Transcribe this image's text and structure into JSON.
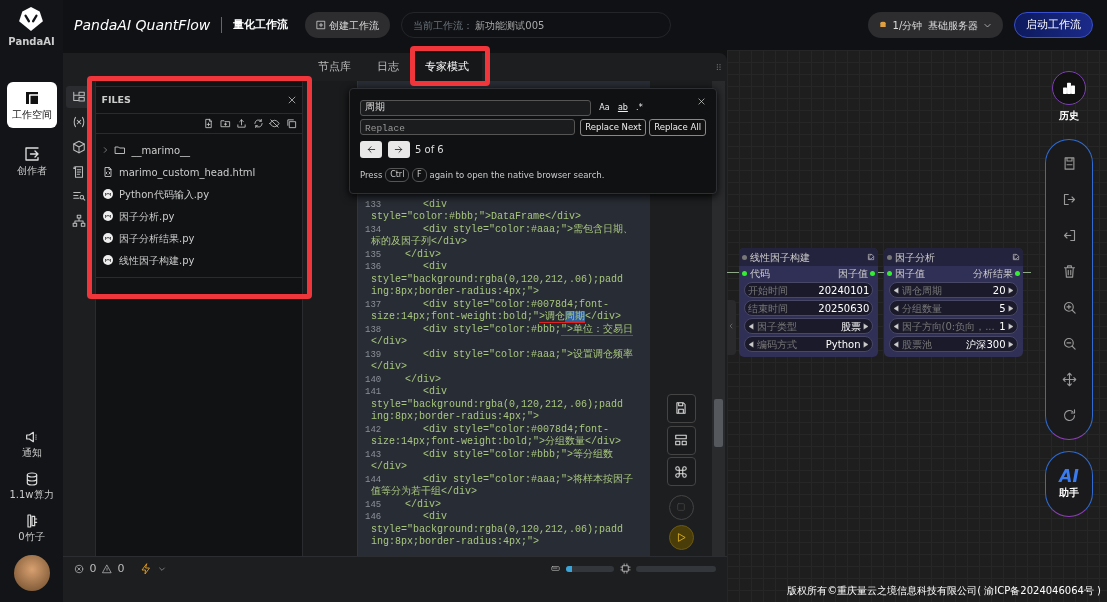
{
  "app": {
    "logo": "PandaAI",
    "title": "PandaAI QuantFlow",
    "subtitle": "量化工作流"
  },
  "rail": {
    "items": [
      {
        "label": "工作空间",
        "selected": true
      },
      {
        "label": "创作者",
        "selected": false
      }
    ],
    "bottom_items": [
      "通知",
      "1.1w算力",
      "0竹子"
    ]
  },
  "header": {
    "create_button": "创建工作流",
    "workflow_label": "当前工作流：",
    "workflow_name": "新功能测试005",
    "server_rate": "1/分钟",
    "server_name": "基础服务器",
    "start_button": "启动工作流"
  },
  "editor": {
    "tabs": [
      {
        "label": "节点库",
        "selected": false
      },
      {
        "label": "日志",
        "selected": false
      },
      {
        "label": "专家模式",
        "selected": true
      }
    ],
    "activity_bar": [
      {
        "selected": true
      },
      {
        "selected": false
      },
      {
        "selected": false
      },
      {
        "selected": false
      },
      {
        "selected": false
      },
      {
        "selected": false
      }
    ],
    "files": {
      "title": "FILES",
      "items": [
        {
          "kind": "folder",
          "name": "__marimo__"
        },
        {
          "kind": "html",
          "name": "marimo_custom_head.html"
        },
        {
          "kind": "notebook",
          "name": "Python代码输入.py"
        },
        {
          "kind": "notebook",
          "name": "因子分析.py"
        },
        {
          "kind": "notebook",
          "name": "因子分析结果.py"
        },
        {
          "kind": "notebook",
          "name": "线性因子构建.py"
        }
      ]
    },
    "find": {
      "query": "周期",
      "replace_placeholder": "Replace",
      "toggles": [
        "Aa",
        "ab",
        ".*"
      ],
      "replace_next": "Replace Next",
      "replace_all": "Replace All",
      "count": "5 of 6",
      "hint": [
        {
          "kind": "text",
          "text": "Press"
        },
        {
          "kind": "key",
          "text": "Ctrl"
        },
        {
          "kind": "key",
          "text": "F"
        },
        {
          "kind": "text",
          "text": "again to open the native browser search."
        }
      ]
    },
    "code_lines": [
      {
        "number": "133",
        "rows": [
          [
            {
              "kind": "plain",
              "text": "    <div"
            }
          ],
          [
            {
              "kind": "plain",
              "text": "style=\"color:#bbb;\">DataFrame</div>"
            }
          ]
        ]
      },
      {
        "number": "134",
        "rows": [
          [
            {
              "kind": "plain",
              "text": "    <div style=\"color:#aaa;\">需包含日期、"
            }
          ],
          [
            {
              "kind": "plain",
              "text": "标的及因子列</div>"
            }
          ]
        ]
      },
      {
        "number": "135",
        "rows": [
          [
            {
              "kind": "plain",
              "text": " </div>"
            }
          ]
        ]
      },
      {
        "number": "136",
        "rows": [
          [
            {
              "kind": "plain",
              "text": "    <div"
            }
          ],
          [
            {
              "kind": "plain",
              "text": "style=\"background:rgba(0,120,212,.06);padd"
            }
          ],
          [
            {
              "kind": "plain",
              "text": "ing:8px;border-radius:4px;\">"
            }
          ]
        ]
      },
      {
        "number": "137",
        "rows": [
          [
            {
              "kind": "plain",
              "text": "    <div style=\"color:#0078d4;font-"
            }
          ],
          [
            {
              "kind": "plain",
              "text": "size:14px;font-weight:bold;\""
            },
            {
              "kind": "flagged",
              "text": ">调仓"
            },
            {
              "kind": "match",
              "text": "周期"
            },
            {
              "kind": "plain",
              "text": "</div>"
            }
          ]
        ]
      },
      {
        "number": "138",
        "rows": [
          [
            {
              "kind": "plain",
              "text": "    <div style=\"color:#bbb;"
            },
            {
              "kind": "flagged",
              "text": "\">单位：交易日"
            }
          ],
          [
            {
              "kind": "plain",
              "text": "</div>"
            }
          ]
        ]
      },
      {
        "number": "139",
        "rows": [
          [
            {
              "kind": "plain",
              "text": "    <div style=\"color:#aaa;\">设置调仓频率"
            }
          ],
          [
            {
              "kind": "plain",
              "text": "</div>"
            }
          ]
        ]
      },
      {
        "number": "140",
        "rows": [
          [
            {
              "kind": "plain",
              "text": " </div>"
            }
          ]
        ]
      },
      {
        "number": "141",
        "rows": [
          [
            {
              "kind": "plain",
              "text": "    <div"
            }
          ],
          [
            {
              "kind": "plain",
              "text": "style=\"background:rgba(0,120,212,.06);padd"
            }
          ],
          [
            {
              "kind": "plain",
              "text": "ing:8px;border-radius:4px;\">"
            }
          ]
        ]
      },
      {
        "number": "142",
        "rows": [
          [
            {
              "kind": "plain",
              "text": "    <div style=\"color:#0078d4;font-"
            }
          ],
          [
            {
              "kind": "plain",
              "text": "size:14px;font-weight:bold;\">分组数量</div>"
            }
          ]
        ]
      },
      {
        "number": "143",
        "rows": [
          [
            {
              "kind": "plain",
              "text": "    <div style=\"color:#bbb;\">等分组数"
            }
          ],
          [
            {
              "kind": "plain",
              "text": "</div>"
            }
          ]
        ]
      },
      {
        "number": "144",
        "rows": [
          [
            {
              "kind": "plain",
              "text": "    <div style=\"color:#aaa;\">将样本按因子"
            }
          ],
          [
            {
              "kind": "plain",
              "text": "值等分为若干组</div>"
            }
          ]
        ]
      },
      {
        "number": "145",
        "rows": [
          [
            {
              "kind": "plain",
              "text": " </div>"
            }
          ]
        ]
      },
      {
        "number": "146",
        "rows": [
          [
            {
              "kind": "plain",
              "text": "    <div"
            }
          ],
          [
            {
              "kind": "plain",
              "text": "style=\"background:rgba(0,120,212,.06);padd"
            }
          ],
          [
            {
              "kind": "plain",
              "text": "ing:8px;border-radius:4px;\">"
            }
          ]
        ]
      }
    ],
    "status": {
      "errors": "0",
      "warnings": "0",
      "memory": {
        "level": 0.12
      },
      "cpu": {
        "level": 0
      }
    }
  },
  "canvas": {
    "nodes": [
      {
        "title": "线性因子构建",
        "input": "代码",
        "output": "因子值",
        "fields": [
          {
            "kind": "text",
            "label": "开始时间",
            "value": "20240101"
          },
          {
            "kind": "text",
            "label": "结束时间",
            "value": "20250630"
          },
          {
            "kind": "stepper",
            "label": "因子类型",
            "value": "股票"
          },
          {
            "kind": "stepper",
            "label": "编码方式",
            "value": "Python"
          }
        ]
      },
      {
        "title": "因子分析",
        "input": "因子值",
        "output": "分析结果",
        "fields": [
          {
            "kind": "stepper",
            "label": "调仓周期",
            "value": "20"
          },
          {
            "kind": "stepper",
            "label": "分组数量",
            "value": "5"
          },
          {
            "kind": "stepper",
            "label": "因子方向(0:负向，...",
            "value": "1"
          },
          {
            "kind": "stepper",
            "label": "股票池",
            "value": "沪深300"
          }
        ]
      }
    ],
    "history": "历史",
    "assistant": {
      "logo": "AI",
      "label": "助手"
    },
    "copyright": "版权所有©重庆量云之境信息科技有限公司( 渝ICP备2024046064号 )"
  }
}
